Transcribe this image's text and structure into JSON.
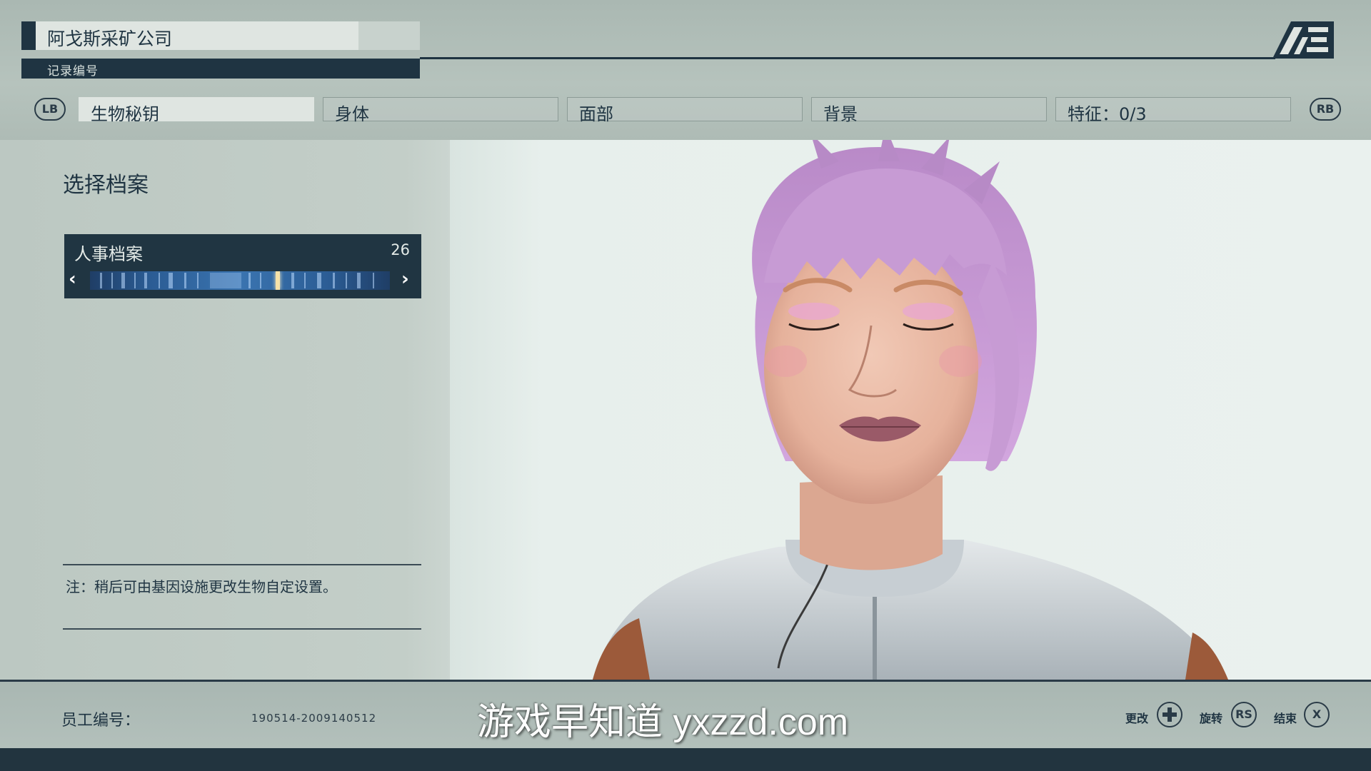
{
  "header": {
    "company_name": "阿戈斯采矿公司",
    "record_label": "记录编号",
    "logo_icon": "ae-logo-icon"
  },
  "tabs": {
    "lb_label": "LB",
    "rb_label": "RB",
    "items": [
      {
        "label": "生物秘钥",
        "active": true
      },
      {
        "label": "身体",
        "active": false
      },
      {
        "label": "面部",
        "active": false
      },
      {
        "label": "背景",
        "active": false
      },
      {
        "label": "特征：0/3",
        "active": false
      }
    ]
  },
  "left_panel": {
    "title": "选择档案",
    "selector": {
      "label": "人事档案",
      "value": "26",
      "prev_icon": "chevron-left-icon",
      "next_icon": "chevron-right-icon"
    },
    "note": "注：稍后可由基因设施更改生物自定设置。"
  },
  "footer": {
    "employee_label": "员工编号：",
    "employee_number": "190514-2009140512",
    "watermark": "游戏早知道 yxzzd.com",
    "actions": [
      {
        "label": "更改",
        "button": "dpad-icon"
      },
      {
        "label": "旋转",
        "button": "RS"
      },
      {
        "label": "结束",
        "button": "X"
      }
    ]
  },
  "colors": {
    "navy": "#1f3442",
    "panel": "#bcc8c2",
    "hair": "#c79bd4",
    "background_portrait": "#eaf1ee"
  }
}
